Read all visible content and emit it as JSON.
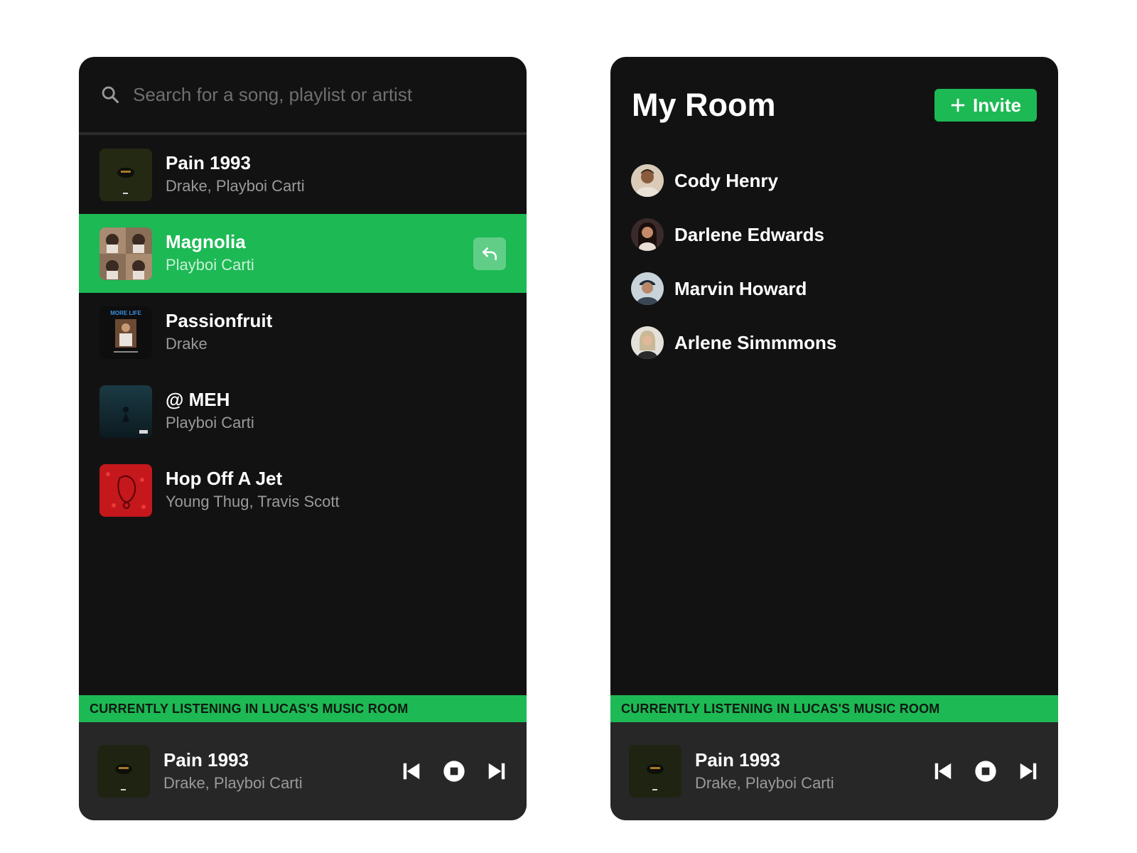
{
  "search": {
    "placeholder": "Search for a song, playlist or artist",
    "icon": "search-icon"
  },
  "songs": [
    {
      "title": "Pain 1993",
      "artist": "Drake, Playboi Carti",
      "active": false
    },
    {
      "title": "Magnolia",
      "artist": "Playboi Carti",
      "active": true,
      "action_icon": "reply-icon"
    },
    {
      "title": "Passionfruit",
      "artist": "Drake",
      "active": false,
      "art_text": "MORE LIFE"
    },
    {
      "title": "@ MEH",
      "artist": "Playboi Carti",
      "active": false
    },
    {
      "title": "Hop Off A Jet",
      "artist": "Young Thug, Travis Scott",
      "active": false
    }
  ],
  "banner": {
    "text": "CURRENTLY LISTENING IN LUCAS'S MUSIC ROOM"
  },
  "now_playing": {
    "title": "Pain 1993",
    "artist": "Drake, Playboi Carti"
  },
  "controls": {
    "previous_icon": "skip-previous-icon",
    "stop_icon": "stop-icon",
    "next_icon": "skip-next-icon"
  },
  "room": {
    "title": "My Room",
    "invite_label": "Invite",
    "members": [
      {
        "name": "Cody Henry"
      },
      {
        "name": "Darlene Edwards"
      },
      {
        "name": "Marvin Howard"
      },
      {
        "name": "Arlene Simmmons"
      }
    ]
  },
  "colors": {
    "accent": "#1db954",
    "panel": "#121212",
    "player": "#272727"
  }
}
